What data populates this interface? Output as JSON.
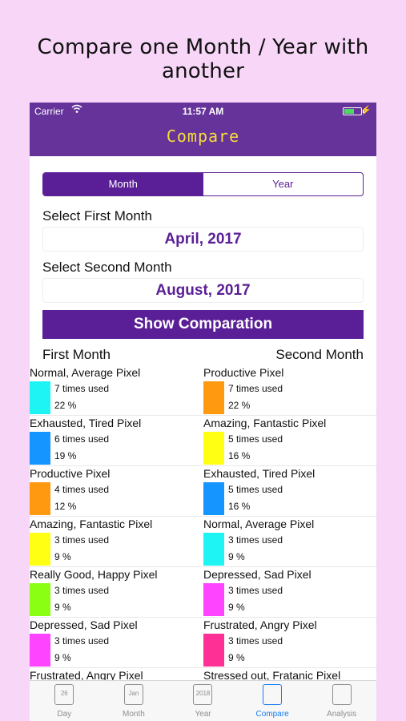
{
  "promo": {
    "headline": "Compare one Month / Year with another"
  },
  "status_bar": {
    "carrier": "Carrier",
    "time": "11:57 AM"
  },
  "nav": {
    "title": "Compare"
  },
  "segment": {
    "month": "Month",
    "year": "Year",
    "selected": "Month"
  },
  "first": {
    "label": "Select First Month",
    "value": "April, 2017"
  },
  "second": {
    "label": "Select Second Month",
    "value": "August, 2017"
  },
  "show_button": "Show Comparation",
  "columns": {
    "left": "First Month",
    "right": "Second Month"
  },
  "rows": [
    {
      "left": {
        "name": "Normal, Average Pixel",
        "count": "7 times used",
        "pct": "22 %",
        "color": "#1ff4f4"
      },
      "right": {
        "name": "Productive Pixel",
        "count": "7 times used",
        "pct": "22 %",
        "color": "#ff9910"
      }
    },
    {
      "left": {
        "name": "Exhausted, Tired Pixel",
        "count": "6 times used",
        "pct": "19 %",
        "color": "#1495ff"
      },
      "right": {
        "name": "Amazing, Fantastic Pixel",
        "count": "5 times used",
        "pct": "16 %",
        "color": "#ffff14"
      }
    },
    {
      "left": {
        "name": "Productive Pixel",
        "count": "4 times used",
        "pct": "12 %",
        "color": "#ff9910"
      },
      "right": {
        "name": "Exhausted, Tired Pixel",
        "count": "5 times used",
        "pct": "16 %",
        "color": "#1495ff"
      }
    },
    {
      "left": {
        "name": "Amazing, Fantastic Pixel",
        "count": "3 times used",
        "pct": "9 %",
        "color": "#ffff14"
      },
      "right": {
        "name": "Normal, Average Pixel",
        "count": "3 times used",
        "pct": "9 %",
        "color": "#1ff4f4"
      }
    },
    {
      "left": {
        "name": "Really Good, Happy Pixel",
        "count": "3 times used",
        "pct": "9 %",
        "color": "#8aff14"
      },
      "right": {
        "name": "Depressed, Sad Pixel",
        "count": "3 times used",
        "pct": "9 %",
        "color": "#ff44ff"
      }
    },
    {
      "left": {
        "name": "Depressed, Sad Pixel",
        "count": "3 times used",
        "pct": "9 %",
        "color": "#ff44ff"
      },
      "right": {
        "name": "Frustrated, Angry Pixel",
        "count": "3 times used",
        "pct": "9 %",
        "color": "#ff3095"
      }
    },
    {
      "left": {
        "name": "Frustrated, Angry Pixel",
        "count": "",
        "pct": "",
        "color": "#ff3095"
      },
      "right": {
        "name": "Stressed out, Fratanic Pixel",
        "count": "",
        "pct": "",
        "color": "#b00000"
      }
    }
  ],
  "tabs": [
    {
      "label": "Day",
      "icon": "calendar-day-icon",
      "glyph": "26"
    },
    {
      "label": "Month",
      "icon": "calendar-month-icon",
      "glyph": "Jan"
    },
    {
      "label": "Year",
      "icon": "calendar-year-icon",
      "glyph": "2018"
    },
    {
      "label": "Compare",
      "icon": "compare-icon",
      "glyph": ""
    },
    {
      "label": "Analysis",
      "icon": "analysis-icon",
      "glyph": ""
    }
  ],
  "active_tab": "Compare",
  "colors": {
    "purple": "#66339a",
    "accent": "#5a1f96",
    "title_yellow": "#f5dd3a",
    "tab_active": "#1a7cf2"
  }
}
